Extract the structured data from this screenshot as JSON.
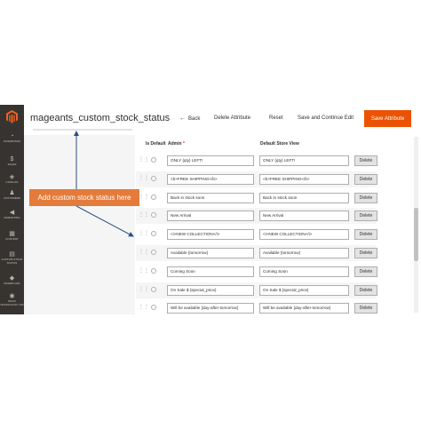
{
  "header": {
    "title": "mageants_custom_stock_status",
    "back_label": "Back",
    "delete_label": "Delete Attribute",
    "reset_label": "Reset",
    "save_continue_label": "Save and Continue Edit",
    "save_label": "Save Attribute"
  },
  "sidebar": {
    "items": [
      {
        "label": "DASHBOARD",
        "icon": "dashboard-icon"
      },
      {
        "label": "SALES",
        "icon": "dollar-icon"
      },
      {
        "label": "CATALOG",
        "icon": "cube-icon"
      },
      {
        "label": "CUSTOMERS",
        "icon": "person-icon"
      },
      {
        "label": "MARKETING",
        "icon": "megaphone-icon"
      },
      {
        "label": "CONTENT",
        "icon": "content-icon"
      },
      {
        "label": "CUSTOM STOCK STATUS",
        "icon": "grid-icon"
      },
      {
        "label": "MAGEPLAZA",
        "icon": "mageplaza-icon"
      },
      {
        "label": "MOCK TECHNOLOGY INC",
        "icon": "circle-icon"
      }
    ]
  },
  "table": {
    "col_default": "Is Default",
    "col_admin": "Admin",
    "col_admin_required": "*",
    "col_store": "Default Store View",
    "delete_label": "Delete",
    "rows": [
      {
        "admin": "ONLY {qty} LEFT!",
        "store": "ONLY {qty} LEFT!"
      },
      {
        "admin": "<b>FREE SHIPPING</b>",
        "store": "<b>FREE SHIPPING</b>"
      },
      {
        "admin": "Back in stock soon",
        "store": "Back in stock soon"
      },
      {
        "admin": "New Arrival",
        "store": "New Arrival"
      },
      {
        "admin": "<i>NEW COLLECTION</i>",
        "store": "<i>NEW COLLECTION</i>"
      },
      {
        "admin": "Available {tomorrow}",
        "store": "Available {tomorrow}"
      },
      {
        "admin": "Coming Soon",
        "store": "Coming Soon"
      },
      {
        "admin": "On Sale $ {special_price}",
        "store": "On Sale $ {special_price}"
      },
      {
        "admin": "Will be available {day-after-tomorrow}",
        "store": "Will be available {day-after-tomorrow}"
      }
    ]
  },
  "callout": {
    "text": "Add custom stock status here"
  },
  "colors": {
    "accent": "#eb5202",
    "sidebar": "#373330",
    "callout": "#e47b3b",
    "arrow": "#2a5082"
  }
}
